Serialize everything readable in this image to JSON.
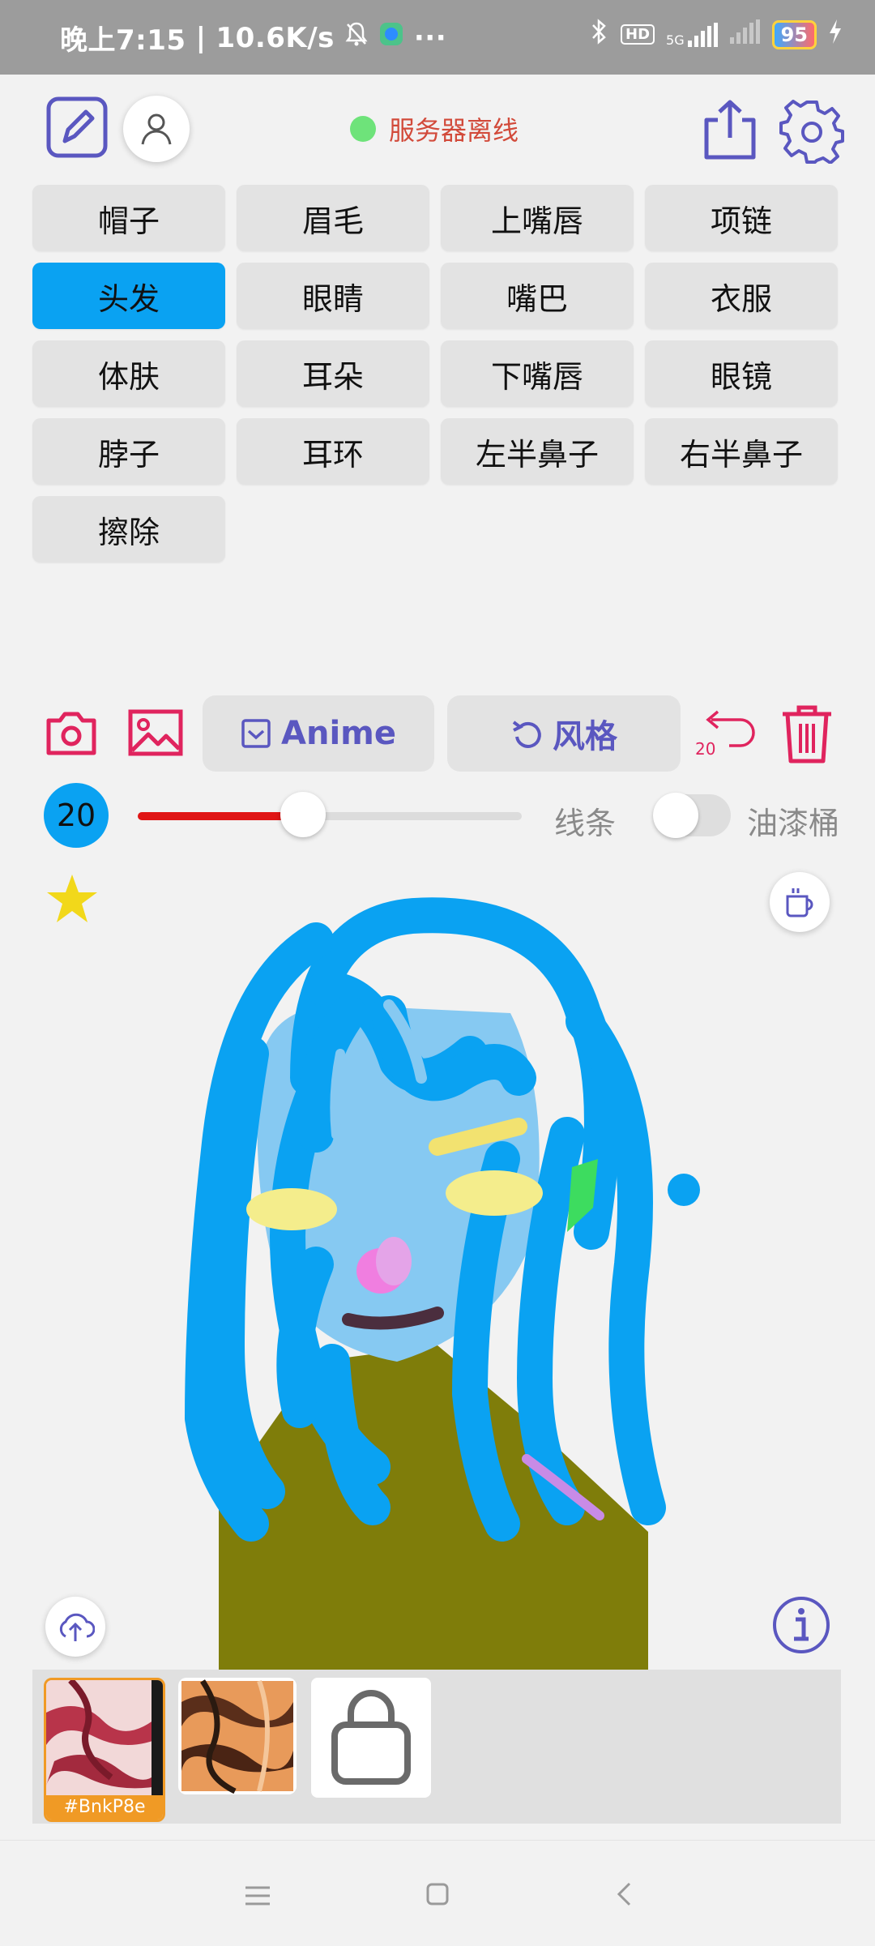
{
  "status_bar": {
    "time": "晚上7:15",
    "speed": "10.6K/s",
    "dots": "···",
    "hd": "HD",
    "network": "5G",
    "battery": "95"
  },
  "header": {
    "server_status": "服务器离线",
    "status_color": "#6ee37a"
  },
  "categories": [
    "帽子",
    "眉毛",
    "上嘴唇",
    "项链",
    "头发",
    "眼睛",
    "嘴巴",
    "衣服",
    "体肤",
    "耳朵",
    "下嘴唇",
    "眼镜",
    "脖子",
    "耳环",
    "左半鼻子",
    "右半鼻子",
    "擦除"
  ],
  "active_category": "头发",
  "toolbar": {
    "anime_label": "Anime",
    "style_label": "风格",
    "undo_count": "20",
    "accent_color": "#e0245e",
    "button_text_color": "#5a57c0"
  },
  "brush": {
    "size": "20",
    "slider_value": 0.43,
    "line_label": "线条",
    "bucket_label": "油漆桶",
    "bucket_enabled": false,
    "color": "#0aa2f2"
  },
  "gallery": {
    "selected_tag": "#BnkP8e"
  }
}
